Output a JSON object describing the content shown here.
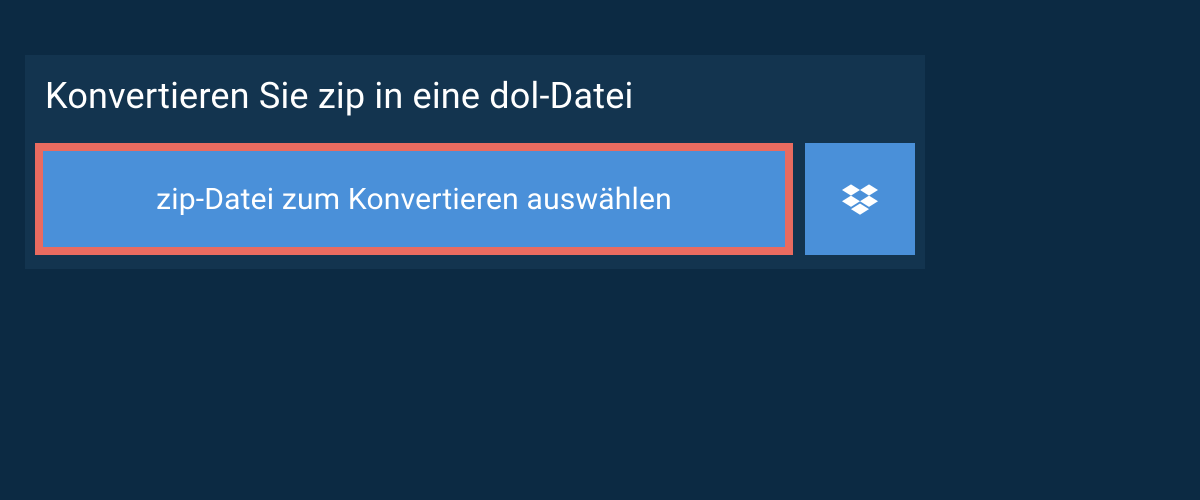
{
  "header": {
    "title": "Konvertieren Sie zip in eine dol-Datei"
  },
  "actions": {
    "choose_file_label": "zip-Datei zum Konvertieren auswählen",
    "dropbox_icon_name": "dropbox"
  },
  "colors": {
    "page_bg": "#0c2a43",
    "panel_bg": "#13344f",
    "button_bg": "#4a90d9",
    "highlight_border": "#e96b60"
  }
}
